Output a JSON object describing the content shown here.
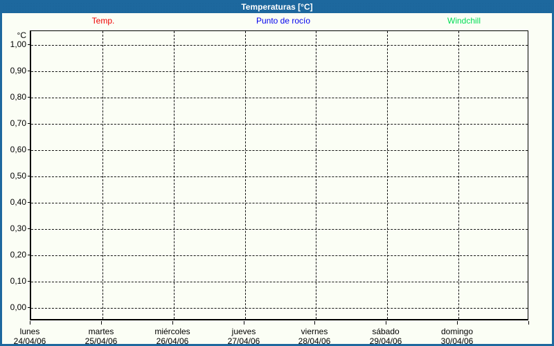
{
  "window": {
    "title": "Temperaturas [°C]"
  },
  "colors": {
    "header_bg": "#1d689e",
    "page_border": "#1d689e",
    "page_bg": "#fbfef5",
    "axis": "#000000",
    "grid": "#111111",
    "title_text": "#ffffff",
    "temp": "#ee0000",
    "dew_point": "#0000ee",
    "windchill": "#00dd55"
  },
  "legend": {
    "items": [
      {
        "id": "temp",
        "label": "Temp.",
        "color": "#ee0000"
      },
      {
        "id": "dew-point",
        "label": "Punto de rocío",
        "color": "#0000ee"
      },
      {
        "id": "windchill",
        "label": "Windchill",
        "color": "#00dd55"
      }
    ]
  },
  "chart_data": {
    "type": "line",
    "title": "Temperaturas [°C]",
    "unit_label": "°C",
    "ylabel": "°C",
    "xlabel": "",
    "ylim": [
      0.0,
      1.0
    ],
    "grid": true,
    "grid_style": "dashed",
    "legend_position": "top",
    "y_ticks": [
      {
        "label": "1,00",
        "value": 1.0
      },
      {
        "label": "0,90",
        "value": 0.9
      },
      {
        "label": "0,80",
        "value": 0.8
      },
      {
        "label": "0,70",
        "value": 0.7
      },
      {
        "label": "0,60",
        "value": 0.6
      },
      {
        "label": "0,50",
        "value": 0.5
      },
      {
        "label": "0,40",
        "value": 0.4
      },
      {
        "label": "0,30",
        "value": 0.3
      },
      {
        "label": "0,20",
        "value": 0.2
      },
      {
        "label": "0,10",
        "value": 0.1
      },
      {
        "label": "0,00",
        "value": 0.0
      }
    ],
    "x_categories": [
      {
        "day": "lunes",
        "date": "24/04/06"
      },
      {
        "day": "martes",
        "date": "25/04/06"
      },
      {
        "day": "miércoles",
        "date": "26/04/06"
      },
      {
        "day": "jueves",
        "date": "27/04/06"
      },
      {
        "day": "viernes",
        "date": "28/04/06"
      },
      {
        "day": "sábado",
        "date": "29/04/06"
      },
      {
        "day": "domingo",
        "date": "30/04/06"
      }
    ],
    "series": [
      {
        "name": "Temp.",
        "color": "#ee0000",
        "values": []
      },
      {
        "name": "Punto de rocío",
        "color": "#0000ee",
        "values": []
      },
      {
        "name": "Windchill",
        "color": "#00dd55",
        "values": []
      }
    ]
  }
}
